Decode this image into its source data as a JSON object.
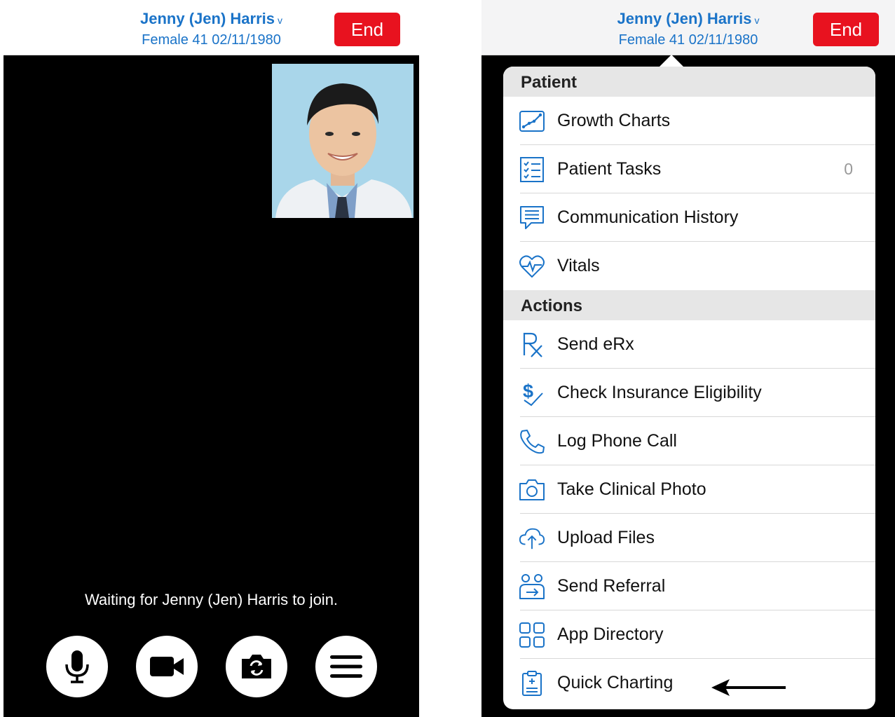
{
  "left_panel": {
    "patient_name": "Jenny (Jen) Harris",
    "name_chevron": "v",
    "patient_demo": "Female 41 02/11/1980",
    "end_label": "End",
    "waiting_text": "Waiting for Jenny (Jen) Harris to join.",
    "controls": [
      {
        "icon": "microphone-icon"
      },
      {
        "icon": "video-camera-icon"
      },
      {
        "icon": "switch-camera-icon"
      },
      {
        "icon": "hamburger-menu-icon"
      }
    ]
  },
  "right_panel": {
    "patient_name": "Jenny (Jen) Harris",
    "name_chevron": "v",
    "patient_demo": "Female 41 02/11/1980",
    "end_label": "End",
    "menu": {
      "patient_header": "Patient",
      "patient_items": [
        {
          "label": "Growth Charts",
          "icon": "growth-chart-icon"
        },
        {
          "label": "Patient Tasks",
          "icon": "checklist-icon",
          "count": "0"
        },
        {
          "label": "Communication History",
          "icon": "message-bubble-icon"
        },
        {
          "label": "Vitals",
          "icon": "heart-pulse-icon"
        }
      ],
      "actions_header": "Actions",
      "action_items": [
        {
          "label": "Send eRx",
          "icon": "rx-icon"
        },
        {
          "label": "Check Insurance Eligibility",
          "icon": "dollar-check-icon"
        },
        {
          "label": "Log Phone Call",
          "icon": "phone-icon"
        },
        {
          "label": "Take Clinical Photo",
          "icon": "camera-icon"
        },
        {
          "label": "Upload Files",
          "icon": "cloud-upload-icon"
        },
        {
          "label": "Send Referral",
          "icon": "referral-icon"
        },
        {
          "label": "App Directory",
          "icon": "app-grid-icon"
        },
        {
          "label": "Quick Charting",
          "icon": "clipboard-icon"
        }
      ]
    }
  },
  "colors": {
    "accent_blue": "#1a73c8",
    "end_red": "#e8121f",
    "icon_blue": "#1a73c8"
  }
}
